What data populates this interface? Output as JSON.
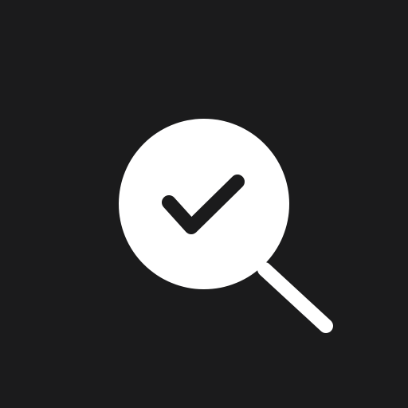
{
  "icon": {
    "semantic_name": "search-check-icon",
    "background_color": "#1b1b1c",
    "foreground_color": "#ffffff"
  }
}
